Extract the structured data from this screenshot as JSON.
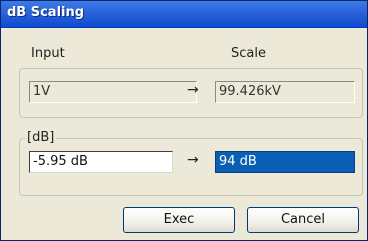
{
  "window": {
    "title": "dB Scaling"
  },
  "top_group": {
    "input_header": "Input",
    "scale_header": "Scale",
    "input_value": "1V",
    "arrow": "→",
    "scale_value": "99.426kV"
  },
  "db_group": {
    "legend": "[dB]",
    "input_value": "-5.95 dB",
    "arrow": "→",
    "scale_value": "94 dB"
  },
  "buttons": {
    "exec_label": "Exec",
    "cancel_label": "Cancel"
  },
  "colors": {
    "titlebar": "#2a62d8",
    "dialog_bg": "#ece9d8",
    "selected_field": "#0a5fb4"
  }
}
